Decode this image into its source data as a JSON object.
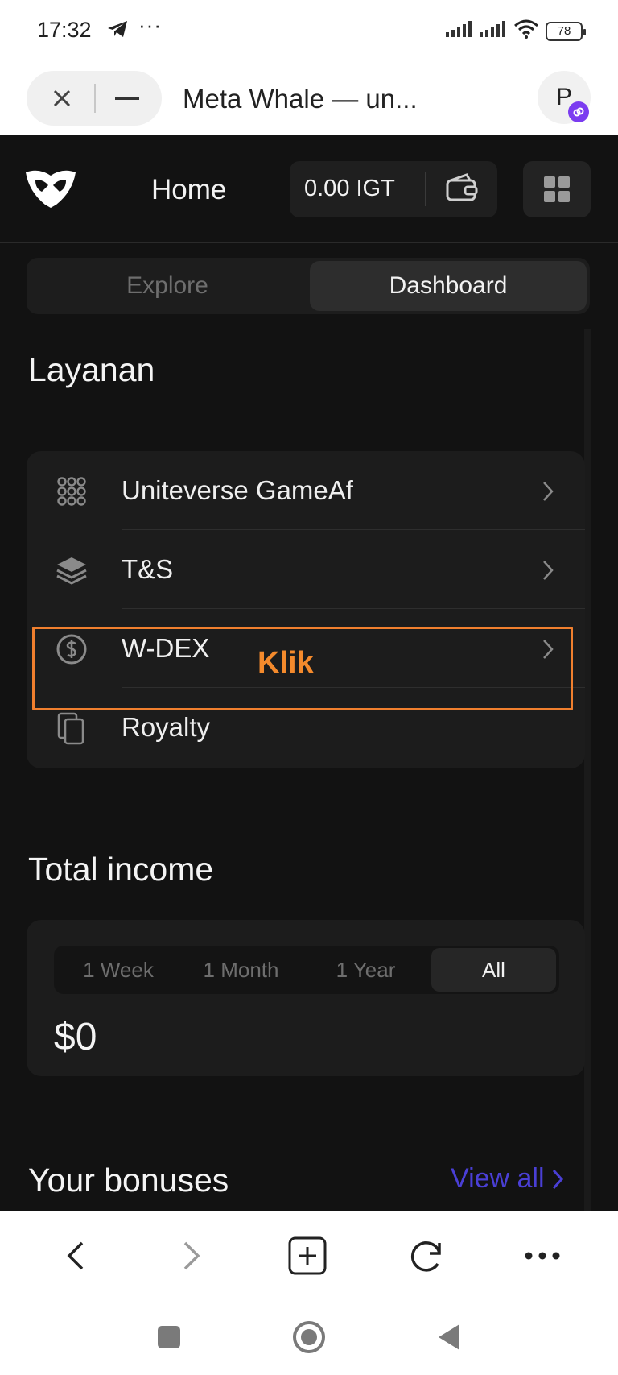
{
  "status_bar": {
    "time": "17:32",
    "more": "···",
    "battery": "78"
  },
  "browser": {
    "tab_title": "Meta Whale — un...",
    "avatar_letter": "P"
  },
  "app": {
    "header": {
      "home_label": "Home",
      "balance": "0.00 IGT"
    },
    "tabs": {
      "explore": "Explore",
      "dashboard": "Dashboard",
      "active": "Dashboard"
    },
    "services": {
      "title": "Layanan",
      "items": [
        {
          "label": "Uniteverse GameAf",
          "icon": "grid-dots-icon"
        },
        {
          "label": "T&S",
          "icon": "layers-icon"
        },
        {
          "label": "W-DEX",
          "icon": "dollar-circle-icon"
        },
        {
          "label": "Royalty",
          "icon": "cards-icon"
        }
      ],
      "annotation": "Klik"
    },
    "income": {
      "title": "Total income",
      "periods": [
        "1 Week",
        "1 Month",
        "1 Year",
        "All"
      ],
      "active_period": "All",
      "amount": "$0"
    },
    "bonuses": {
      "title": "Your bonuses",
      "view_all": "View all"
    }
  },
  "colors": {
    "background": "#121212",
    "card": "#1c1c1c",
    "highlight": "#f07f2e",
    "link": "#4a3fd6"
  }
}
